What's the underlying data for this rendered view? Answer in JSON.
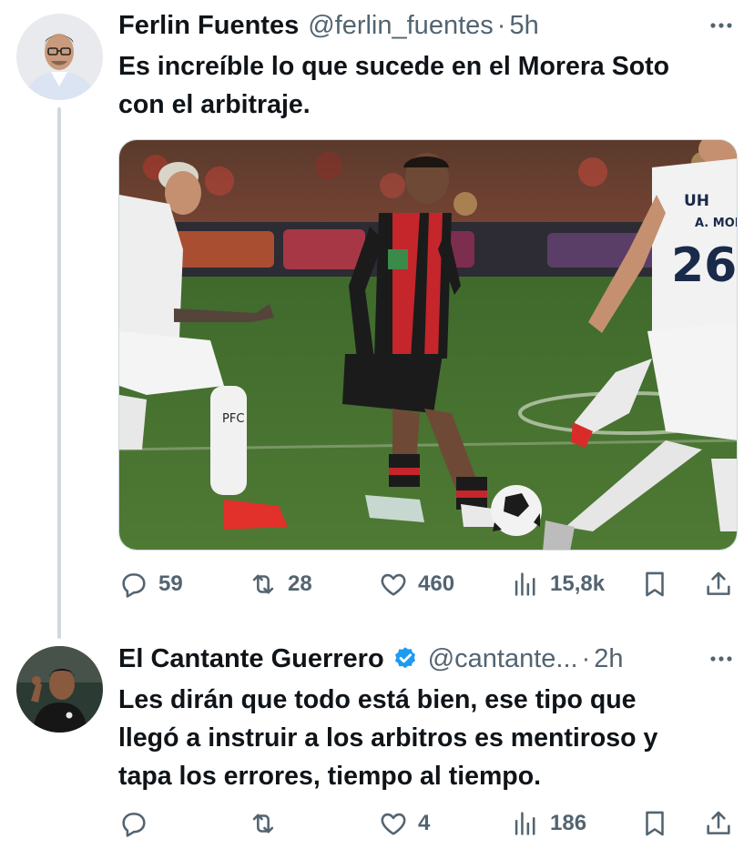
{
  "tweets": [
    {
      "author_name": "Ferlin Fuentes",
      "handle": "@ferlin_fuentes",
      "separator": "·",
      "time": "5h",
      "text_lines": [
        "Es increíble lo que sucede en el Morera Soto",
        "con el arbitraje."
      ],
      "media_jersey_numbers": [
        "26"
      ],
      "media_jersey_text": [
        "A. MORA",
        "UH",
        "PFC"
      ],
      "actions": {
        "replies": "59",
        "reposts": "28",
        "likes": "460",
        "views": "15,8k"
      },
      "icons": [
        "reply-icon",
        "repost-icon",
        "like-icon",
        "views-icon",
        "bookmark-icon",
        "share-icon",
        "more-icon"
      ]
    },
    {
      "author_name": "El Cantante Guerrero",
      "verified": true,
      "verified_color": "#1d9bf0",
      "handle": "@cantante...",
      "separator": "·",
      "time": "2h",
      "text_lines": [
        "Les dirán que todo está bien, ese tipo que",
        "llegó a instruir a los arbitros es mentiroso y",
        "tapa los errores, tiempo al tiempo."
      ],
      "actions": {
        "replies": "",
        "reposts": "",
        "likes": "4",
        "views": "186"
      },
      "icons": [
        "reply-icon",
        "repost-icon",
        "like-icon",
        "views-icon",
        "bookmark-icon",
        "share-icon",
        "more-icon"
      ]
    }
  ],
  "colors": {
    "text_primary": "#0f1419",
    "text_secondary": "#536471",
    "thread_line": "#cfd9de",
    "verified": "#1d9bf0"
  }
}
